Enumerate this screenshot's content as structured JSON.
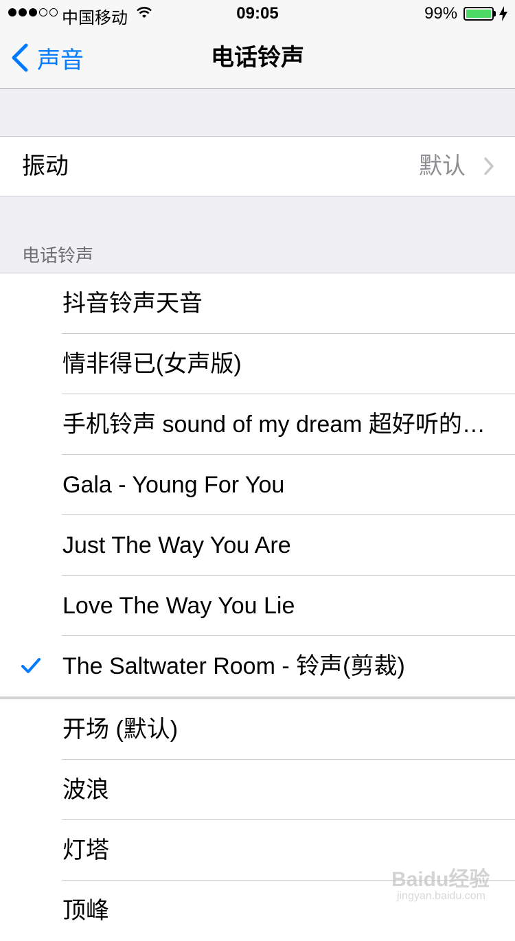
{
  "status_bar": {
    "carrier": "中国移动",
    "time": "09:05",
    "battery": "99%",
    "signal_bars_filled": 3,
    "signal_bars_total": 5,
    "battery_color": "#4cd964"
  },
  "nav": {
    "back_label": "声音",
    "title": "电话铃声",
    "accent": "#007aff"
  },
  "vibration": {
    "label": "振动",
    "value": "默认"
  },
  "ringtones": {
    "header": "电话铃声",
    "items": [
      {
        "label": "抖音铃声天音",
        "checked": false
      },
      {
        "label": "情非得已(女声版)",
        "checked": false
      },
      {
        "label": "手机铃声 sound of my dream 超好听的…",
        "checked": false
      },
      {
        "label": "Gala - Young For You",
        "checked": false
      },
      {
        "label": "Just The Way You Are",
        "checked": false
      },
      {
        "label": "Love The Way You Lie",
        "checked": false
      },
      {
        "label": "The Saltwater Room - 铃声(剪裁)",
        "checked": true
      },
      {
        "label": "开场 (默认)",
        "checked": false
      },
      {
        "label": "波浪",
        "checked": false
      },
      {
        "label": "灯塔",
        "checked": false
      },
      {
        "label": "顶峰",
        "checked": false
      }
    ]
  },
  "watermark": {
    "text": "Baidu经验",
    "url_text": "jingyan.baidu.com"
  }
}
